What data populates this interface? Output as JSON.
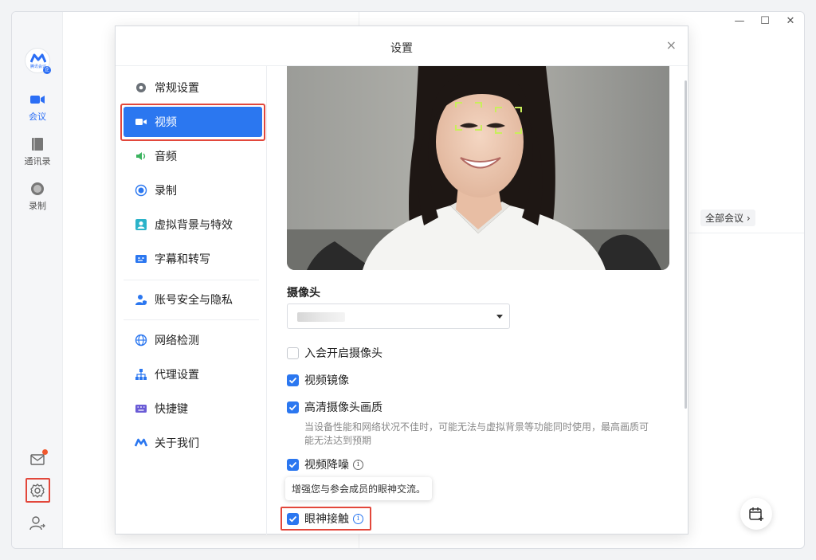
{
  "rail": {
    "logo_text": "腾讯会议",
    "logo_badge": "企",
    "items": [
      {
        "label": "会议",
        "icon": "video-camera-icon"
      },
      {
        "label": "通讯录",
        "icon": "contacts-book-icon"
      },
      {
        "label": "录制",
        "icon": "record-icon"
      }
    ],
    "bottom_icons": [
      "mail-icon",
      "gear-icon",
      "user-switch-icon"
    ]
  },
  "window_controls": {
    "minimize": "—",
    "maximize": "☐",
    "close": "✕"
  },
  "background": {
    "all_meetings": "全部会议 ›"
  },
  "dialog": {
    "title": "设置",
    "close": "×",
    "nav": [
      {
        "label": "常规设置",
        "icon": "gear-icon"
      },
      {
        "label": "视频",
        "icon": "video-camera-icon"
      },
      {
        "label": "音频",
        "icon": "speaker-icon"
      },
      {
        "label": "录制",
        "icon": "record-icon"
      },
      {
        "label": "虚拟背景与特效",
        "icon": "portrait-icon"
      },
      {
        "label": "字幕和转写",
        "icon": "caption-icon"
      },
      {
        "label": "账号安全与隐私",
        "icon": "shield-user-icon"
      },
      {
        "label": "网络检测",
        "icon": "globe-icon"
      },
      {
        "label": "代理设置",
        "icon": "network-tree-icon"
      },
      {
        "label": "快捷键",
        "icon": "keyboard-icon"
      },
      {
        "label": "关于我们",
        "icon": "logo-icon"
      }
    ],
    "video": {
      "camera_label": "摄像头",
      "options": [
        {
          "label": "入会开启摄像头",
          "checked": false
        },
        {
          "label": "视频镜像",
          "checked": true
        },
        {
          "label": "高清摄像头画质",
          "checked": true
        },
        {
          "label": "视频降噪",
          "checked": true
        },
        {
          "label": "眼神接触",
          "checked": true
        }
      ],
      "hd_hint": "当设备性能和网络状况不佳时，可能无法与虚拟背景等功能同时使用，最高画质可能无法达到预期",
      "tooltip": "增强您与参会成员的眼神交流。"
    }
  },
  "colors": {
    "accent": "#2b77f0",
    "highlight": "#e2473b"
  }
}
